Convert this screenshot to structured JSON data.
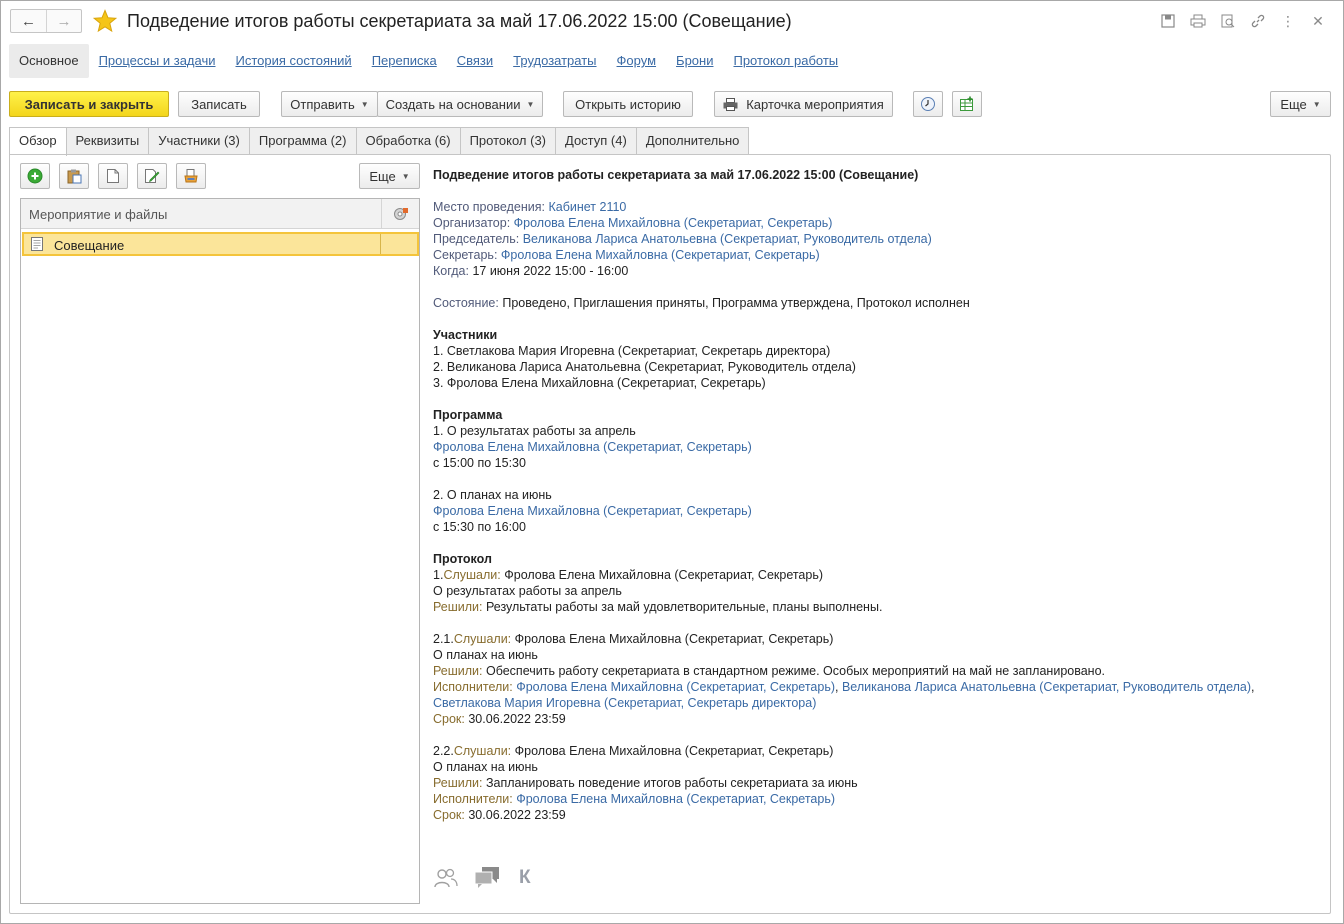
{
  "window": {
    "title": "Подведение итогов работы секретариата за май 17.06.2022 15:00 (Совещание)"
  },
  "sections": [
    {
      "label": "Основное"
    },
    {
      "label": "Процессы и задачи"
    },
    {
      "label": "История состояний"
    },
    {
      "label": "Переписка"
    },
    {
      "label": "Связи"
    },
    {
      "label": "Трудозатраты"
    },
    {
      "label": "Форум"
    },
    {
      "label": "Брони"
    },
    {
      "label": "Протокол работы"
    }
  ],
  "toolbar": {
    "save_close": "Записать и закрыть",
    "save": "Записать",
    "send": "Отправить",
    "create_based": "Создать на основании",
    "open_history": "Открыть историю",
    "event_card": "Карточка мероприятия",
    "more": "Еще"
  },
  "tabs": [
    {
      "label": "Обзор"
    },
    {
      "label": "Реквизиты"
    },
    {
      "label": "Участники (3)"
    },
    {
      "label": "Программа (2)"
    },
    {
      "label": "Обработка (6)"
    },
    {
      "label": "Протокол (3)"
    },
    {
      "label": "Доступ (4)"
    },
    {
      "label": "Дополнительно"
    }
  ],
  "left_panel": {
    "more": "Еще",
    "column_header": "Мероприятие и файлы",
    "rows": [
      {
        "label": "Совещание"
      }
    ]
  },
  "overview": {
    "heading": "Подведение итогов работы секретариата за май 17.06.2022 15:00 (Совещание)",
    "place_label": "Место проведения:",
    "place_value": "Кабинет 2110",
    "organizer_label": "Организатор:",
    "organizer_value": "Фролова Елена Михайловна (Секретариат, Секретарь)",
    "chair_label": "Председатель:",
    "chair_value": "Великанова Лариса Анатольевна (Секретариат, Руководитель отдела)",
    "secretary_label": "Секретарь:",
    "secretary_value": "Фролова Елена Михайловна (Секретариат, Секретарь)",
    "when_label": "Когда:",
    "when_value": "17 июня 2022 15:00 - 16:00",
    "state_label": "Состояние:",
    "state_value": "Проведено, Приглашения приняты, Программа утверждена, Протокол исполнен",
    "participants_heading": "Участники",
    "participants": [
      "1. Светлакова Мария Игоревна (Секретариат, Секретарь директора)",
      "2. Великанова Лариса Анатольевна (Секретариат, Руководитель отдела)",
      "3. Фролова Елена Михайловна (Секретариат, Секретарь)"
    ],
    "program_heading": "Программа",
    "program": [
      {
        "title": "1. О результатах работы за апрель",
        "speaker": "Фролова Елена Михайловна (Секретариат, Секретарь)",
        "time": "с 15:00 по 15:30"
      },
      {
        "title": "2. О планах на июнь",
        "speaker": "Фролова Елена Михайловна (Секретариат, Секретарь)",
        "time": "с 15:30 по 16:00"
      }
    ],
    "protocol_heading": "Протокол",
    "protocol": [
      {
        "num": "1.",
        "heard_label": "Слушали:",
        "heard": "Фролова Елена Михайловна (Секретариат, Секретарь)",
        "subject": "О результатах работы за апрель",
        "decided_label": "Решили:",
        "decided": "Результаты работы за май удовлетворительные, планы выполнены."
      },
      {
        "num": "2.1.",
        "heard_label": "Слушали:",
        "heard": "Фролова Елена Михайловна (Секретариат, Секретарь)",
        "subject": "О планах на июнь",
        "decided_label": "Решили:",
        "decided": "Обеспечить работу секретариата в стандартном режиме. Особых мероприятий на май не запланировано.",
        "executors_label": "Исполнители:",
        "executor_1": "Фролова Елена Михайловна (Секретариат, Секретарь)",
        "executor_2": "Великанова Лариса Анатольевна (Секретариат, Руководитель отдела)",
        "executor_3": "Светлакова Мария Игоревна (Секретариат, Секретарь директора)",
        "deadline_label": "Срок:",
        "deadline": "30.06.2022 23:59"
      },
      {
        "num": "2.2.",
        "heard_label": "Слушали:",
        "heard": "Фролова Елена Михайловна (Секретариат, Секретарь)",
        "subject": "О планах на июнь",
        "decided_label": "Решили:",
        "decided": "Запланировать поведение итогов работы секретариата за июнь",
        "executors_label": "Исполнители:",
        "executor_1": "Фролова Елена Михайловна (Секретариат, Секретарь)",
        "deadline_label": "Срок:",
        "deadline": "30.06.2022 23:59"
      }
    ],
    "bottom_letter": "К"
  },
  "colors": {
    "primary_button": "#f3d51b",
    "link": "#3a6aa5",
    "selected_row": "#fbe59a"
  }
}
